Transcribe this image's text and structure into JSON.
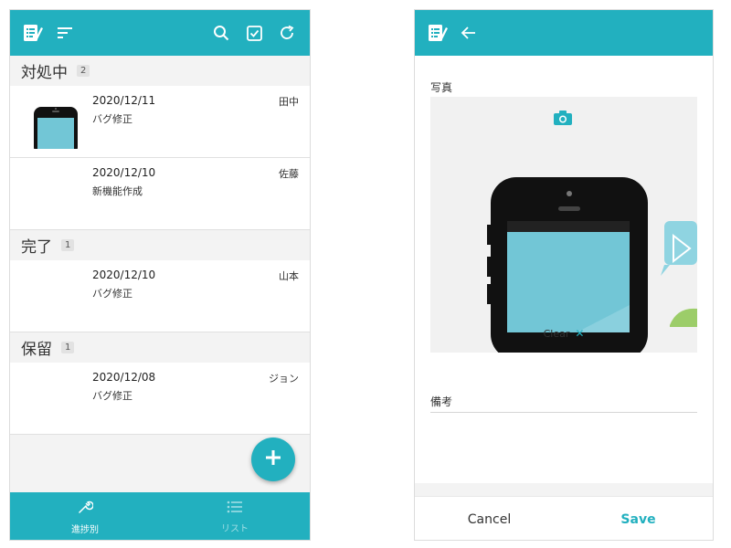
{
  "colors": {
    "accent": "#22b0bf",
    "screen_bg": "#f3f3f3"
  },
  "left_screen": {
    "appbar": {
      "icons": [
        "app-logo-icon",
        "sort-icon",
        "search-icon",
        "checkbox-icon",
        "refresh-icon"
      ]
    },
    "sections": [
      {
        "title": "対処中",
        "count": "2",
        "items": [
          {
            "date": "2020/12/11",
            "title": "バグ修正",
            "assignee": "田中",
            "has_thumbnail": true
          },
          {
            "date": "2020/12/10",
            "title": "新機能作成",
            "assignee": "佐藤",
            "has_thumbnail": false
          }
        ]
      },
      {
        "title": "完了",
        "count": "1",
        "items": [
          {
            "date": "2020/12/10",
            "title": "バグ修正",
            "assignee": "山本",
            "has_thumbnail": false
          }
        ]
      },
      {
        "title": "保留",
        "count": "1",
        "items": [
          {
            "date": "2020/12/08",
            "title": "バグ修正",
            "assignee": "ジョン",
            "has_thumbnail": false
          }
        ]
      }
    ],
    "fab": {
      "icon": "plus-icon"
    },
    "bottom_nav": [
      {
        "label": "進捗別",
        "icon": "wrench-icon",
        "active": true
      },
      {
        "label": "リスト",
        "icon": "list-icon",
        "active": false
      }
    ]
  },
  "right_screen": {
    "appbar": {
      "icons": [
        "app-logo-icon",
        "back-arrow-icon"
      ]
    },
    "photo_label": "写真",
    "clear_label": "Clear",
    "note_label": "備考",
    "note_value": "",
    "cancel_label": "Cancel",
    "save_label": "Save"
  }
}
